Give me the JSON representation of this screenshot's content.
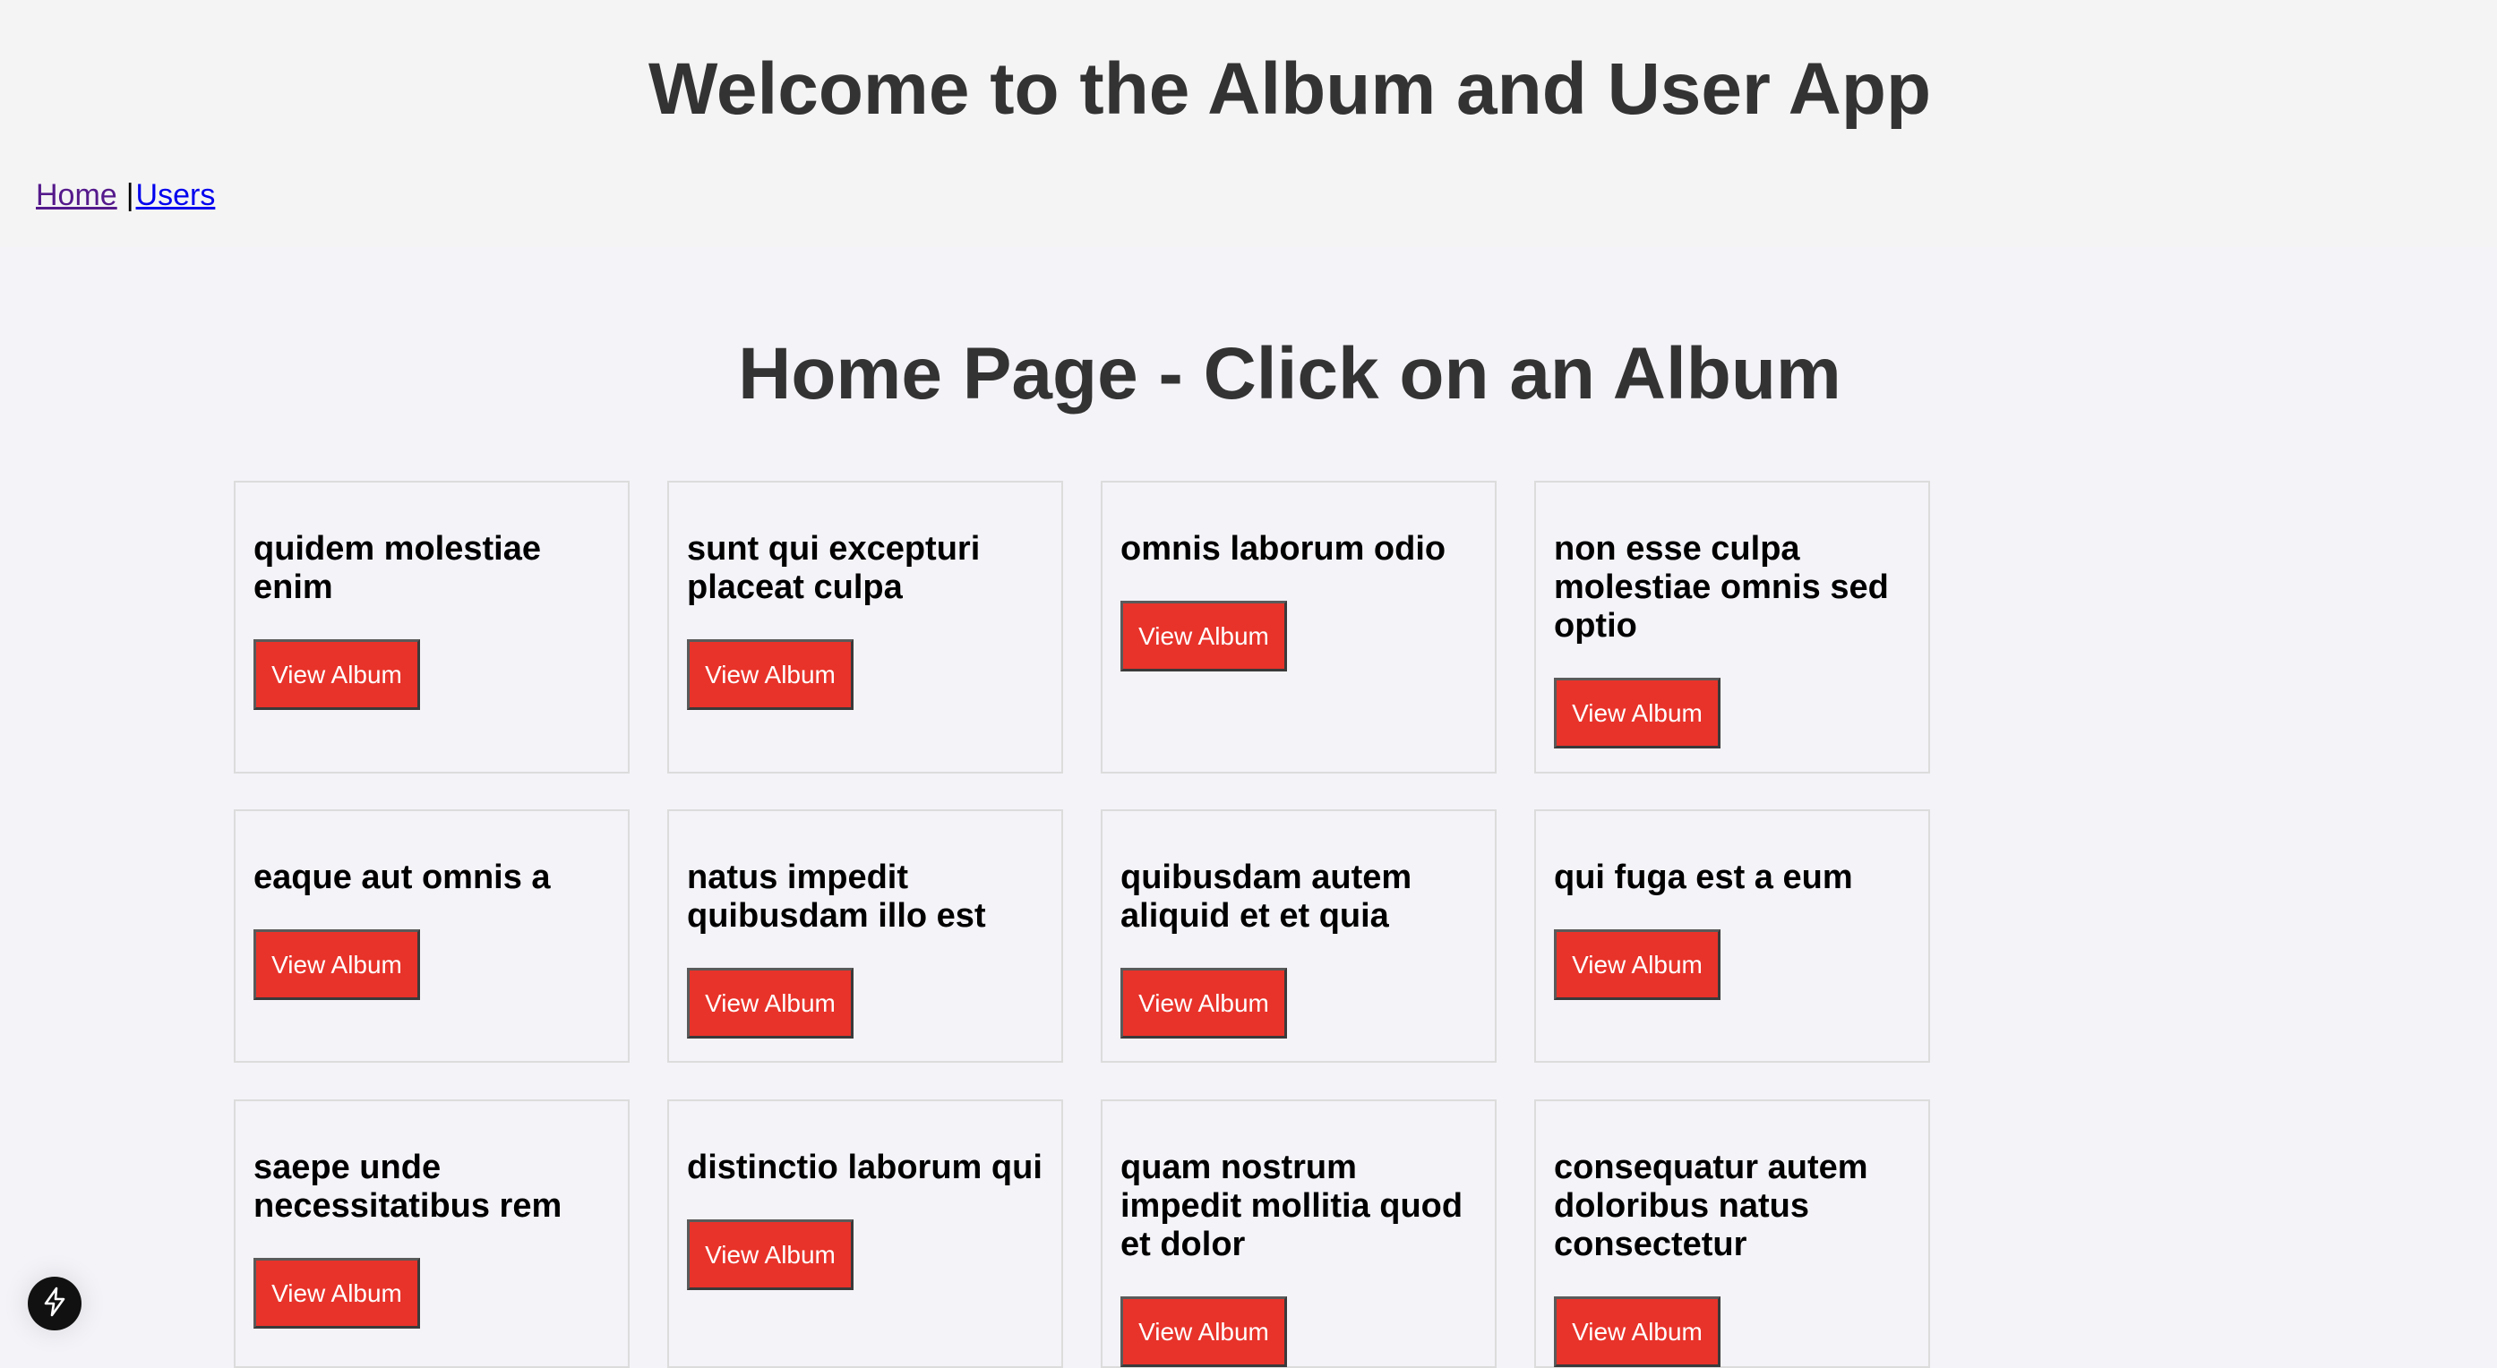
{
  "header": {
    "title": "Welcome to the Album and User App",
    "nav": {
      "home_label": "Home",
      "separator": "|",
      "users_label": "Users"
    }
  },
  "main": {
    "page_title": "Home Page - Click on an Album",
    "button_label": "View Album",
    "albums": [
      {
        "title": "quidem molestiae enim"
      },
      {
        "title": "sunt qui excepturi placeat culpa"
      },
      {
        "title": "omnis laborum odio"
      },
      {
        "title": "non esse culpa molestiae omnis sed optio"
      },
      {
        "title": "eaque aut omnis a"
      },
      {
        "title": "natus impedit quibusdam illo est"
      },
      {
        "title": "quibusdam autem aliquid et et quia"
      },
      {
        "title": "qui fuga est a eum"
      },
      {
        "title": "saepe unde necessitatibus rem"
      },
      {
        "title": "distinctio laborum qui"
      },
      {
        "title": "quam nostrum impedit mollitia quod et dolor"
      },
      {
        "title": "consequatur autem doloribus natus consectetur"
      }
    ]
  },
  "dev_indicator": {
    "icon": "lightning-bolt-icon"
  },
  "colors": {
    "button_bg": "#e8332a",
    "button_text": "#ffffff",
    "heading": "#333333",
    "card_border": "#dcdcdc",
    "link": "#0000ee",
    "visited_link": "#551a8b"
  }
}
